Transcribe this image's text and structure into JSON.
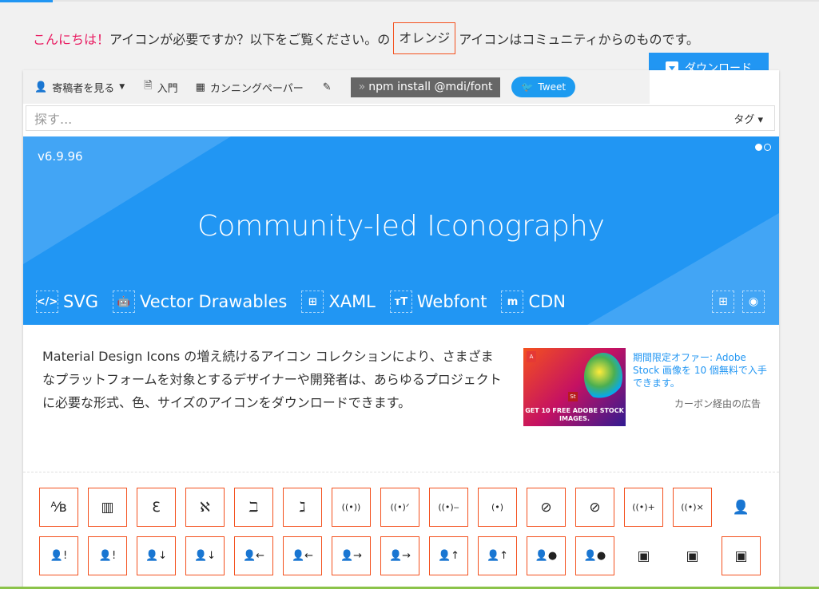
{
  "greeting": {
    "hello": "こんにちは！",
    "before": "アイコンが必要ですか？以下をご覧ください。の",
    "orange": "オレンジ",
    "after": "アイコンはコミュニティからのものです。"
  },
  "download_label": "ダウンロード",
  "toolbar": {
    "contributors": "寄稿者を見る",
    "intro": "入門",
    "cheatsheet": "カンニングペーパー",
    "npm_command": "npm install @mdi/font",
    "tweet": "Tweet"
  },
  "search": {
    "placeholder": "探す...",
    "tag": "タグ"
  },
  "hero": {
    "version": "v6.9.96",
    "title": "Community-led Iconography",
    "links": [
      "SVG",
      "Vector Drawables",
      "XAML",
      "Webfont",
      "CDN"
    ]
  },
  "description": "Material Design Icons の増え続けるアイコン コレクションにより、さまざまなプラットフォームを対象とするデザイナーや開発者は、あらゆるプロジェクトに必要な形式、色、サイズのアイコンをダウンロードできます。",
  "ad": {
    "text": "期間限定オファー: Adobe Stock 画像を 10 個無料で入手できます。",
    "via": "カーボン経由の広告",
    "image_text": "GET 10 FREE ADOBE STOCK IMAGES.",
    "brand_mark": "St"
  },
  "icons": {
    "row1": [
      "ᴬ⁄ʙ",
      "▥",
      "ℇ",
      "ℵ",
      "ℶ",
      "ℷ",
      "((•))",
      "((•)ᐟ",
      "((•)‒",
      "(•)",
      "⊘",
      "⊘",
      "((•)+",
      "((•)×",
      "👤"
    ],
    "row2": [
      "👤!",
      "👤!",
      "👤↓",
      "👤↓",
      "👤←",
      "👤←",
      "👤→",
      "👤→",
      "👤↑",
      "👤↑",
      "👤●",
      "👤●",
      "▣",
      "▣",
      "▣"
    ]
  }
}
